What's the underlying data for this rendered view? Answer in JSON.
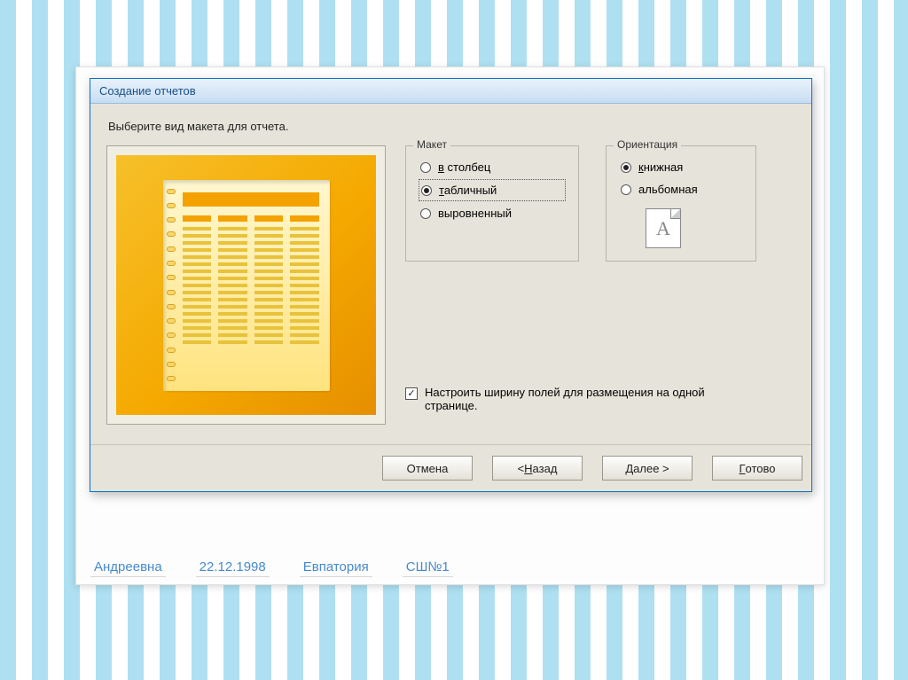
{
  "dialog": {
    "title": "Создание отчетов",
    "instruction": "Выберите вид макета для отчета."
  },
  "layout_group": {
    "legend": "Макет",
    "options": {
      "columnar": {
        "label": "в столбец",
        "accel": "в",
        "checked": false
      },
      "tabular": {
        "label": "табличный",
        "accel": "т",
        "checked": true
      },
      "justified": {
        "label": "выровненный",
        "accel": "в",
        "checked": false
      }
    }
  },
  "orient_group": {
    "legend": "Ориентация",
    "options": {
      "portrait": {
        "label": "книжная",
        "accel": "к",
        "checked": true
      },
      "landscape": {
        "label": "альбомная",
        "accel": "а",
        "checked": false
      }
    }
  },
  "fit_checkbox": {
    "checked": true,
    "label": "Настроить ширину полей для размещения на одной странице."
  },
  "buttons": {
    "cancel": "Отмена",
    "back": "< Назад",
    "next": "Далее >",
    "finish": "Готово"
  },
  "button_accel": {
    "back": "Н",
    "next": "Д",
    "finish": "Г"
  },
  "background_row": {
    "c1": "Андреевна",
    "c2": "22.12.1998",
    "c3": "Евпатория",
    "c4": "СШ№1"
  },
  "orient_icon_glyph": "A"
}
